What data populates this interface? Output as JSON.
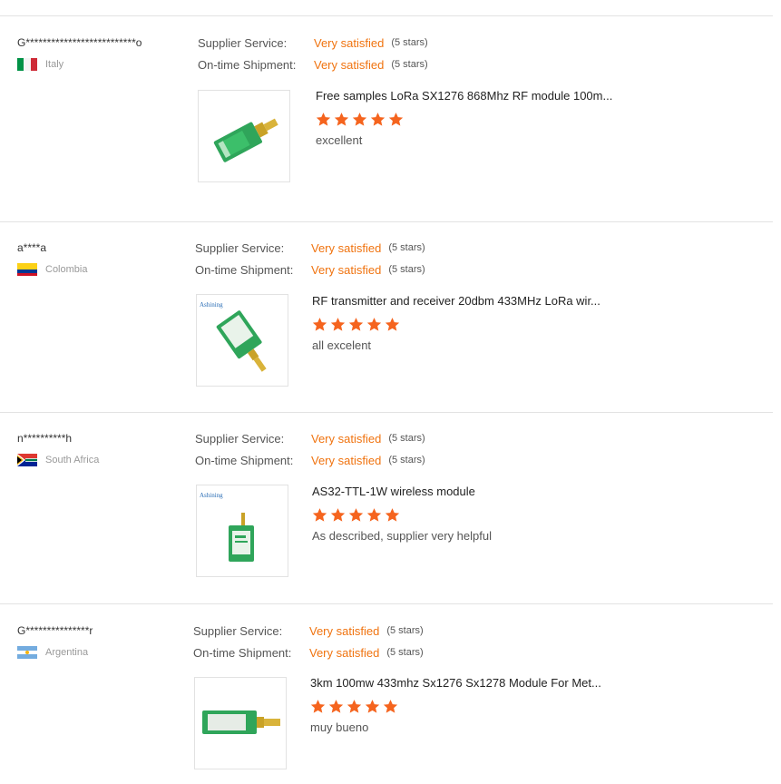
{
  "ratings_labels": {
    "supplier_service": "Supplier Service:",
    "on_time_shipment": "On-time Shipment:"
  },
  "reviews": [
    {
      "user": "G**************************o",
      "country": "Italy",
      "flag": "italy",
      "supplier_service": "Very satisfied",
      "supplier_service_stars": "(5 stars)",
      "on_time_shipment": "Very satisfied",
      "on_time_shipment_stars": "(5 stars)",
      "product_title": "Free samples LoRa SX1276 868Mhz RF module 100m...",
      "rating": 5,
      "comment": "excellent"
    },
    {
      "user": "a****a",
      "country": "Colombia",
      "flag": "colombia",
      "supplier_service": "Very satisfied",
      "supplier_service_stars": "(5 stars)",
      "on_time_shipment": "Very satisfied",
      "on_time_shipment_stars": "(5 stars)",
      "product_title": "RF transmitter and receiver 20dbm 433MHz LoRa wir...",
      "rating": 5,
      "comment": "all excelent",
      "image_brand": "Ashining"
    },
    {
      "user": "n**********h",
      "country": "South Africa",
      "flag": "south-africa",
      "supplier_service": "Very satisfied",
      "supplier_service_stars": "(5 stars)",
      "on_time_shipment": "Very satisfied",
      "on_time_shipment_stars": "(5 stars)",
      "product_title": "AS32-TTL-1W wireless module",
      "rating": 5,
      "comment": "As described, supplier very helpful",
      "image_brand": "Ashining"
    },
    {
      "user": "G***************r",
      "country": "Argentina",
      "flag": "argentina",
      "supplier_service": "Very satisfied",
      "supplier_service_stars": "(5 stars)",
      "on_time_shipment": "Very satisfied",
      "on_time_shipment_stars": "(5 stars)",
      "product_title": "3km 100mw 433mhz Sx1276 Sx1278 Module For Met...",
      "rating": 5,
      "comment": "muy bueno"
    }
  ],
  "colors": {
    "accent": "#f0730f",
    "star": "#f5641e",
    "divider": "#e2e2e2"
  }
}
